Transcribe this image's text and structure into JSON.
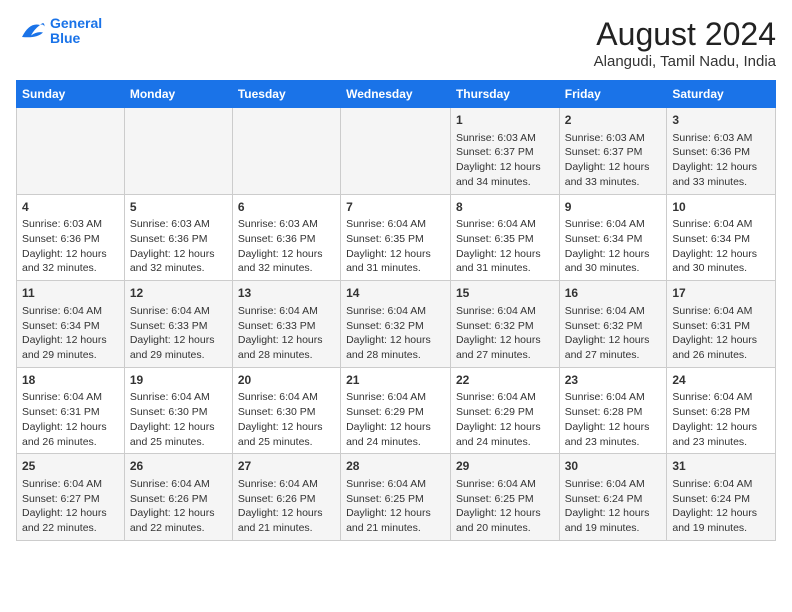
{
  "logo": {
    "line1": "General",
    "line2": "Blue"
  },
  "title": "August 2024",
  "subtitle": "Alangudi, Tamil Nadu, India",
  "headers": [
    "Sunday",
    "Monday",
    "Tuesday",
    "Wednesday",
    "Thursday",
    "Friday",
    "Saturday"
  ],
  "weeks": [
    [
      {
        "day": "",
        "info": ""
      },
      {
        "day": "",
        "info": ""
      },
      {
        "day": "",
        "info": ""
      },
      {
        "day": "",
        "info": ""
      },
      {
        "day": "1",
        "info": "Sunrise: 6:03 AM\nSunset: 6:37 PM\nDaylight: 12 hours\nand 34 minutes."
      },
      {
        "day": "2",
        "info": "Sunrise: 6:03 AM\nSunset: 6:37 PM\nDaylight: 12 hours\nand 33 minutes."
      },
      {
        "day": "3",
        "info": "Sunrise: 6:03 AM\nSunset: 6:36 PM\nDaylight: 12 hours\nand 33 minutes."
      }
    ],
    [
      {
        "day": "4",
        "info": "Sunrise: 6:03 AM\nSunset: 6:36 PM\nDaylight: 12 hours\nand 32 minutes."
      },
      {
        "day": "5",
        "info": "Sunrise: 6:03 AM\nSunset: 6:36 PM\nDaylight: 12 hours\nand 32 minutes."
      },
      {
        "day": "6",
        "info": "Sunrise: 6:03 AM\nSunset: 6:36 PM\nDaylight: 12 hours\nand 32 minutes."
      },
      {
        "day": "7",
        "info": "Sunrise: 6:04 AM\nSunset: 6:35 PM\nDaylight: 12 hours\nand 31 minutes."
      },
      {
        "day": "8",
        "info": "Sunrise: 6:04 AM\nSunset: 6:35 PM\nDaylight: 12 hours\nand 31 minutes."
      },
      {
        "day": "9",
        "info": "Sunrise: 6:04 AM\nSunset: 6:34 PM\nDaylight: 12 hours\nand 30 minutes."
      },
      {
        "day": "10",
        "info": "Sunrise: 6:04 AM\nSunset: 6:34 PM\nDaylight: 12 hours\nand 30 minutes."
      }
    ],
    [
      {
        "day": "11",
        "info": "Sunrise: 6:04 AM\nSunset: 6:34 PM\nDaylight: 12 hours\nand 29 minutes."
      },
      {
        "day": "12",
        "info": "Sunrise: 6:04 AM\nSunset: 6:33 PM\nDaylight: 12 hours\nand 29 minutes."
      },
      {
        "day": "13",
        "info": "Sunrise: 6:04 AM\nSunset: 6:33 PM\nDaylight: 12 hours\nand 28 minutes."
      },
      {
        "day": "14",
        "info": "Sunrise: 6:04 AM\nSunset: 6:32 PM\nDaylight: 12 hours\nand 28 minutes."
      },
      {
        "day": "15",
        "info": "Sunrise: 6:04 AM\nSunset: 6:32 PM\nDaylight: 12 hours\nand 27 minutes."
      },
      {
        "day": "16",
        "info": "Sunrise: 6:04 AM\nSunset: 6:32 PM\nDaylight: 12 hours\nand 27 minutes."
      },
      {
        "day": "17",
        "info": "Sunrise: 6:04 AM\nSunset: 6:31 PM\nDaylight: 12 hours\nand 26 minutes."
      }
    ],
    [
      {
        "day": "18",
        "info": "Sunrise: 6:04 AM\nSunset: 6:31 PM\nDaylight: 12 hours\nand 26 minutes."
      },
      {
        "day": "19",
        "info": "Sunrise: 6:04 AM\nSunset: 6:30 PM\nDaylight: 12 hours\nand 25 minutes."
      },
      {
        "day": "20",
        "info": "Sunrise: 6:04 AM\nSunset: 6:30 PM\nDaylight: 12 hours\nand 25 minutes."
      },
      {
        "day": "21",
        "info": "Sunrise: 6:04 AM\nSunset: 6:29 PM\nDaylight: 12 hours\nand 24 minutes."
      },
      {
        "day": "22",
        "info": "Sunrise: 6:04 AM\nSunset: 6:29 PM\nDaylight: 12 hours\nand 24 minutes."
      },
      {
        "day": "23",
        "info": "Sunrise: 6:04 AM\nSunset: 6:28 PM\nDaylight: 12 hours\nand 23 minutes."
      },
      {
        "day": "24",
        "info": "Sunrise: 6:04 AM\nSunset: 6:28 PM\nDaylight: 12 hours\nand 23 minutes."
      }
    ],
    [
      {
        "day": "25",
        "info": "Sunrise: 6:04 AM\nSunset: 6:27 PM\nDaylight: 12 hours\nand 22 minutes."
      },
      {
        "day": "26",
        "info": "Sunrise: 6:04 AM\nSunset: 6:26 PM\nDaylight: 12 hours\nand 22 minutes."
      },
      {
        "day": "27",
        "info": "Sunrise: 6:04 AM\nSunset: 6:26 PM\nDaylight: 12 hours\nand 21 minutes."
      },
      {
        "day": "28",
        "info": "Sunrise: 6:04 AM\nSunset: 6:25 PM\nDaylight: 12 hours\nand 21 minutes."
      },
      {
        "day": "29",
        "info": "Sunrise: 6:04 AM\nSunset: 6:25 PM\nDaylight: 12 hours\nand 20 minutes."
      },
      {
        "day": "30",
        "info": "Sunrise: 6:04 AM\nSunset: 6:24 PM\nDaylight: 12 hours\nand 19 minutes."
      },
      {
        "day": "31",
        "info": "Sunrise: 6:04 AM\nSunset: 6:24 PM\nDaylight: 12 hours\nand 19 minutes."
      }
    ]
  ]
}
